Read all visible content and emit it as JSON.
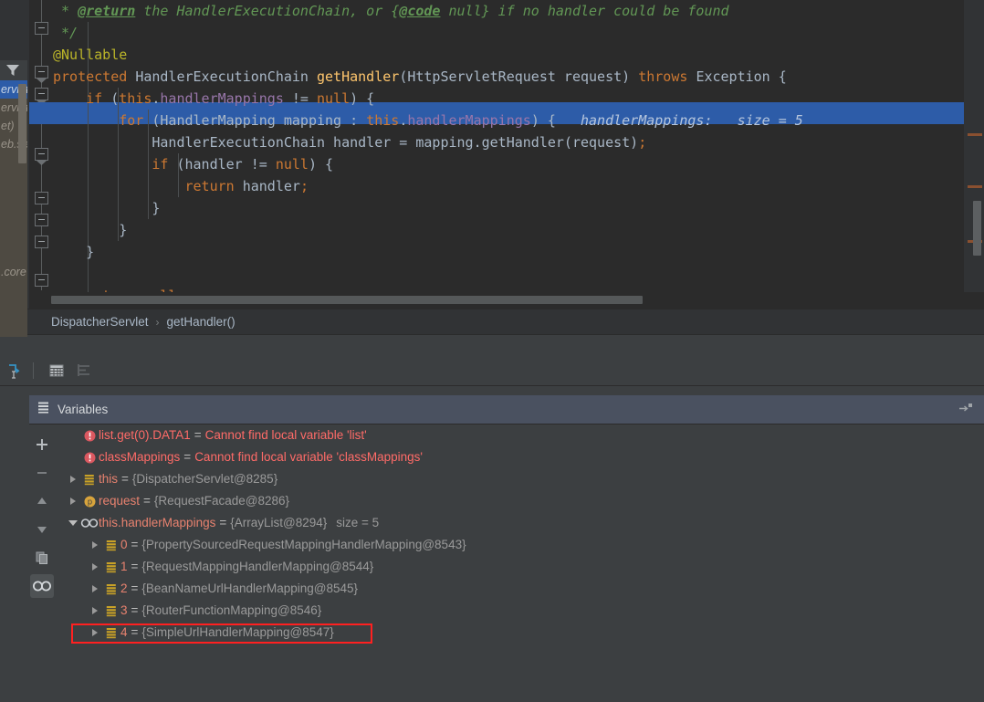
{
  "editor": {
    "lines": [
      {
        "indent": 0,
        "tokens": [
          {
            "t": " * ",
            "c": "tok-doc"
          },
          {
            "t": "@return",
            "c": "tok-doc-tag"
          },
          {
            "t": " the HandlerExecutionChain, or {",
            "c": "tok-doc"
          },
          {
            "t": "@code",
            "c": "tok-doc-tag"
          },
          {
            "t": " null} if no handler could be found",
            "c": "tok-doc"
          }
        ]
      },
      {
        "indent": 0,
        "tokens": [
          {
            "t": " */",
            "c": "tok-doc"
          }
        ]
      },
      {
        "indent": 0,
        "tokens": [
          {
            "t": "@Nullable",
            "c": "tok-anno"
          }
        ]
      },
      {
        "indent": 0,
        "tokens": [
          {
            "t": "protected ",
            "c": "tok-kw"
          },
          {
            "t": "HandlerExecutionChain ",
            "c": "tok-ident"
          },
          {
            "t": "getHandler",
            "c": "tok-method"
          },
          {
            "t": "(HttpServletRequest request) ",
            "c": "tok-ident"
          },
          {
            "t": "throws ",
            "c": "tok-kw"
          },
          {
            "t": "Exception {",
            "c": "tok-ident"
          }
        ]
      },
      {
        "indent": 1,
        "tokens": [
          {
            "t": "if ",
            "c": "tok-kw"
          },
          {
            "t": "(",
            "c": "tok-ident"
          },
          {
            "t": "this",
            "c": "tok-kw"
          },
          {
            "t": ".",
            "c": "tok-ident"
          },
          {
            "t": "handlerMappings",
            "c": "tok-field"
          },
          {
            "t": " != ",
            "c": "tok-ident"
          },
          {
            "t": "null",
            "c": "tok-kw"
          },
          {
            "t": ") {",
            "c": "tok-ident"
          }
        ]
      },
      {
        "indent": 2,
        "highlighted": true,
        "tokens": [
          {
            "t": "for ",
            "c": "tok-kw"
          },
          {
            "t": "(HandlerMapping mapping : ",
            "c": "tok-ident"
          },
          {
            "t": "this",
            "c": "tok-kw"
          },
          {
            "t": ".",
            "c": "tok-ident"
          },
          {
            "t": "handlerMappings",
            "c": "tok-field"
          },
          {
            "t": ") {",
            "c": "tok-ident"
          },
          {
            "t": "   handlerMappings:   size = 5",
            "c": "tok-inline-hint-sel"
          }
        ]
      },
      {
        "indent": 3,
        "tokens": [
          {
            "t": "HandlerExecutionChain handler = mapping.getHandler(request)",
            "c": "tok-ident"
          },
          {
            "t": ";",
            "c": "tok-kw"
          }
        ]
      },
      {
        "indent": 3,
        "tokens": [
          {
            "t": "if ",
            "c": "tok-kw"
          },
          {
            "t": "(handler != ",
            "c": "tok-ident"
          },
          {
            "t": "null",
            "c": "tok-kw"
          },
          {
            "t": ") {",
            "c": "tok-ident"
          }
        ]
      },
      {
        "indent": 4,
        "tokens": [
          {
            "t": "return ",
            "c": "tok-kw"
          },
          {
            "t": "handler",
            "c": "tok-ident"
          },
          {
            "t": ";",
            "c": "tok-kw"
          }
        ]
      },
      {
        "indent": 3,
        "tokens": [
          {
            "t": "}",
            "c": "tok-ident"
          }
        ]
      },
      {
        "indent": 2,
        "tokens": [
          {
            "t": "}",
            "c": "tok-ident"
          }
        ]
      },
      {
        "indent": 1,
        "tokens": [
          {
            "t": "}",
            "c": "tok-ident"
          }
        ]
      },
      {
        "indent": 0,
        "tokens": []
      },
      {
        "indent": 1,
        "tokens": [
          {
            "t": "return ",
            "c": "tok-kw"
          },
          {
            "t": "null",
            "c": "tok-kw"
          },
          {
            "t": ";",
            "c": "tok-kw"
          }
        ]
      },
      {
        "indent": 0,
        "tokens": [
          {
            "t": "}",
            "c": "tok-ident"
          }
        ]
      }
    ],
    "inline_hint": "handlerMappings:   size = 5",
    "highlight_color": "#2d5ca8",
    "background": "#2b2b2b"
  },
  "breadcrumb": {
    "class_name": "DispatcherServlet",
    "separator": "›",
    "method_name": "getHandler()"
  },
  "debug_toolbar": {
    "icons": [
      {
        "name": "jump-to-source-icon"
      },
      {
        "name": "table-view-icon"
      },
      {
        "name": "sort-values-icon"
      }
    ]
  },
  "frames": {
    "filter_label": "",
    "rows": [
      {
        "text": "ervlet",
        "selected": true
      },
      {
        "text": "ervlet",
        "selected": false
      },
      {
        "text": "et)",
        "selected": false
      },
      {
        "text": "eb.se",
        "selected": false
      },
      {
        "text": "",
        "selected": false
      },
      {
        "text": "",
        "selected": false
      },
      {
        "text": "",
        "selected": false
      },
      {
        "text": "",
        "selected": false
      },
      {
        "text": "",
        "selected": false
      },
      {
        "text": "",
        "selected": false
      },
      {
        "text": ".core",
        "selected": false
      }
    ]
  },
  "watch_toolbar": {
    "buttons": [
      {
        "name": "add-watch-button",
        "glyph": "+",
        "active": false
      },
      {
        "name": "remove-watch-button",
        "glyph": "−",
        "active": false
      },
      {
        "name": "move-watch-up-button",
        "glyph": "▲",
        "active": false
      },
      {
        "name": "move-watch-down-button",
        "glyph": "▼",
        "active": false
      },
      {
        "name": "copy-watch-button",
        "glyph": "⧉",
        "active": false
      },
      {
        "name": "watches-toggle-button",
        "glyph": "∞",
        "active": true
      }
    ]
  },
  "variables_panel": {
    "tab_label": "Variables",
    "tab_background": "#4a5160",
    "hide_icon": "hide-panel-icon",
    "rows": [
      {
        "id": "row-list-data1",
        "indent": 1,
        "twisty": "none",
        "icon": "error-icon",
        "name": "list.get(0).DATA1",
        "name_class": "vname-err",
        "eq": "=",
        "value": "Cannot find local variable 'list'",
        "value_class": "vval-err",
        "size": "",
        "highlighted": false
      },
      {
        "id": "row-classmappings",
        "indent": 1,
        "twisty": "none",
        "icon": "error-icon",
        "name": "classMappings",
        "name_class": "vname-err",
        "eq": "=",
        "value": "Cannot find local variable 'classMappings'",
        "value_class": "vval-err",
        "size": "",
        "highlighted": false
      },
      {
        "id": "row-this",
        "indent": 1,
        "twisty": "closed",
        "icon": "object-field-icon",
        "name": "this",
        "name_class": "vname",
        "eq": "=",
        "value": "{DispatcherServlet@8285}",
        "value_class": "vval",
        "size": "",
        "highlighted": false
      },
      {
        "id": "row-request",
        "indent": 1,
        "twisty": "closed",
        "icon": "parameter-icon",
        "name": "request",
        "name_class": "vname",
        "eq": "=",
        "value": "{RequestFacade@8286}",
        "value_class": "vval",
        "size": "",
        "highlighted": false
      },
      {
        "id": "row-handlermappings",
        "indent": 1,
        "twisty": "open",
        "icon": "watch-icon",
        "name": "this.handlerMappings",
        "name_class": "vname",
        "eq": "=",
        "value": "{ArrayList@8294}",
        "value_class": "vval",
        "size": "size = 5",
        "highlighted": false
      },
      {
        "id": "row-index-0",
        "indent": 2,
        "twisty": "closed",
        "icon": "object-field-icon",
        "name": "0",
        "name_class": "vidx",
        "eq": "=",
        "value": "{PropertySourcedRequestMappingHandlerMapping@8543}",
        "value_class": "vval",
        "size": "",
        "highlighted": false
      },
      {
        "id": "row-index-1",
        "indent": 2,
        "twisty": "closed",
        "icon": "object-field-icon",
        "name": "1",
        "name_class": "vidx",
        "eq": "=",
        "value": "{RequestMappingHandlerMapping@8544}",
        "value_class": "vval",
        "size": "",
        "highlighted": false
      },
      {
        "id": "row-index-2",
        "indent": 2,
        "twisty": "closed",
        "icon": "object-field-icon",
        "name": "2",
        "name_class": "vidx",
        "eq": "=",
        "value": "{BeanNameUrlHandlerMapping@8545}",
        "value_class": "vval",
        "size": "",
        "highlighted": false
      },
      {
        "id": "row-index-3",
        "indent": 2,
        "twisty": "closed",
        "icon": "object-field-icon",
        "name": "3",
        "name_class": "vidx",
        "eq": "=",
        "value": "{RouterFunctionMapping@8546}",
        "value_class": "vval",
        "size": "",
        "highlighted": false
      },
      {
        "id": "row-index-4",
        "indent": 2,
        "twisty": "closed",
        "icon": "object-field-icon",
        "name": "4",
        "name_class": "vidx",
        "eq": "=",
        "value": "{SimpleUrlHandlerMapping@8547}",
        "value_class": "vval",
        "size": "",
        "highlighted": true,
        "highlight_color": "#ff2020"
      }
    ]
  },
  "gutter": {
    "run_icon": "run-method-icon",
    "breakpoint_icon": "breakpoint-verified-icon",
    "stripe_marks_y": [
      148,
      205,
      265
    ],
    "stripe_mark_color": "#8a5030"
  }
}
